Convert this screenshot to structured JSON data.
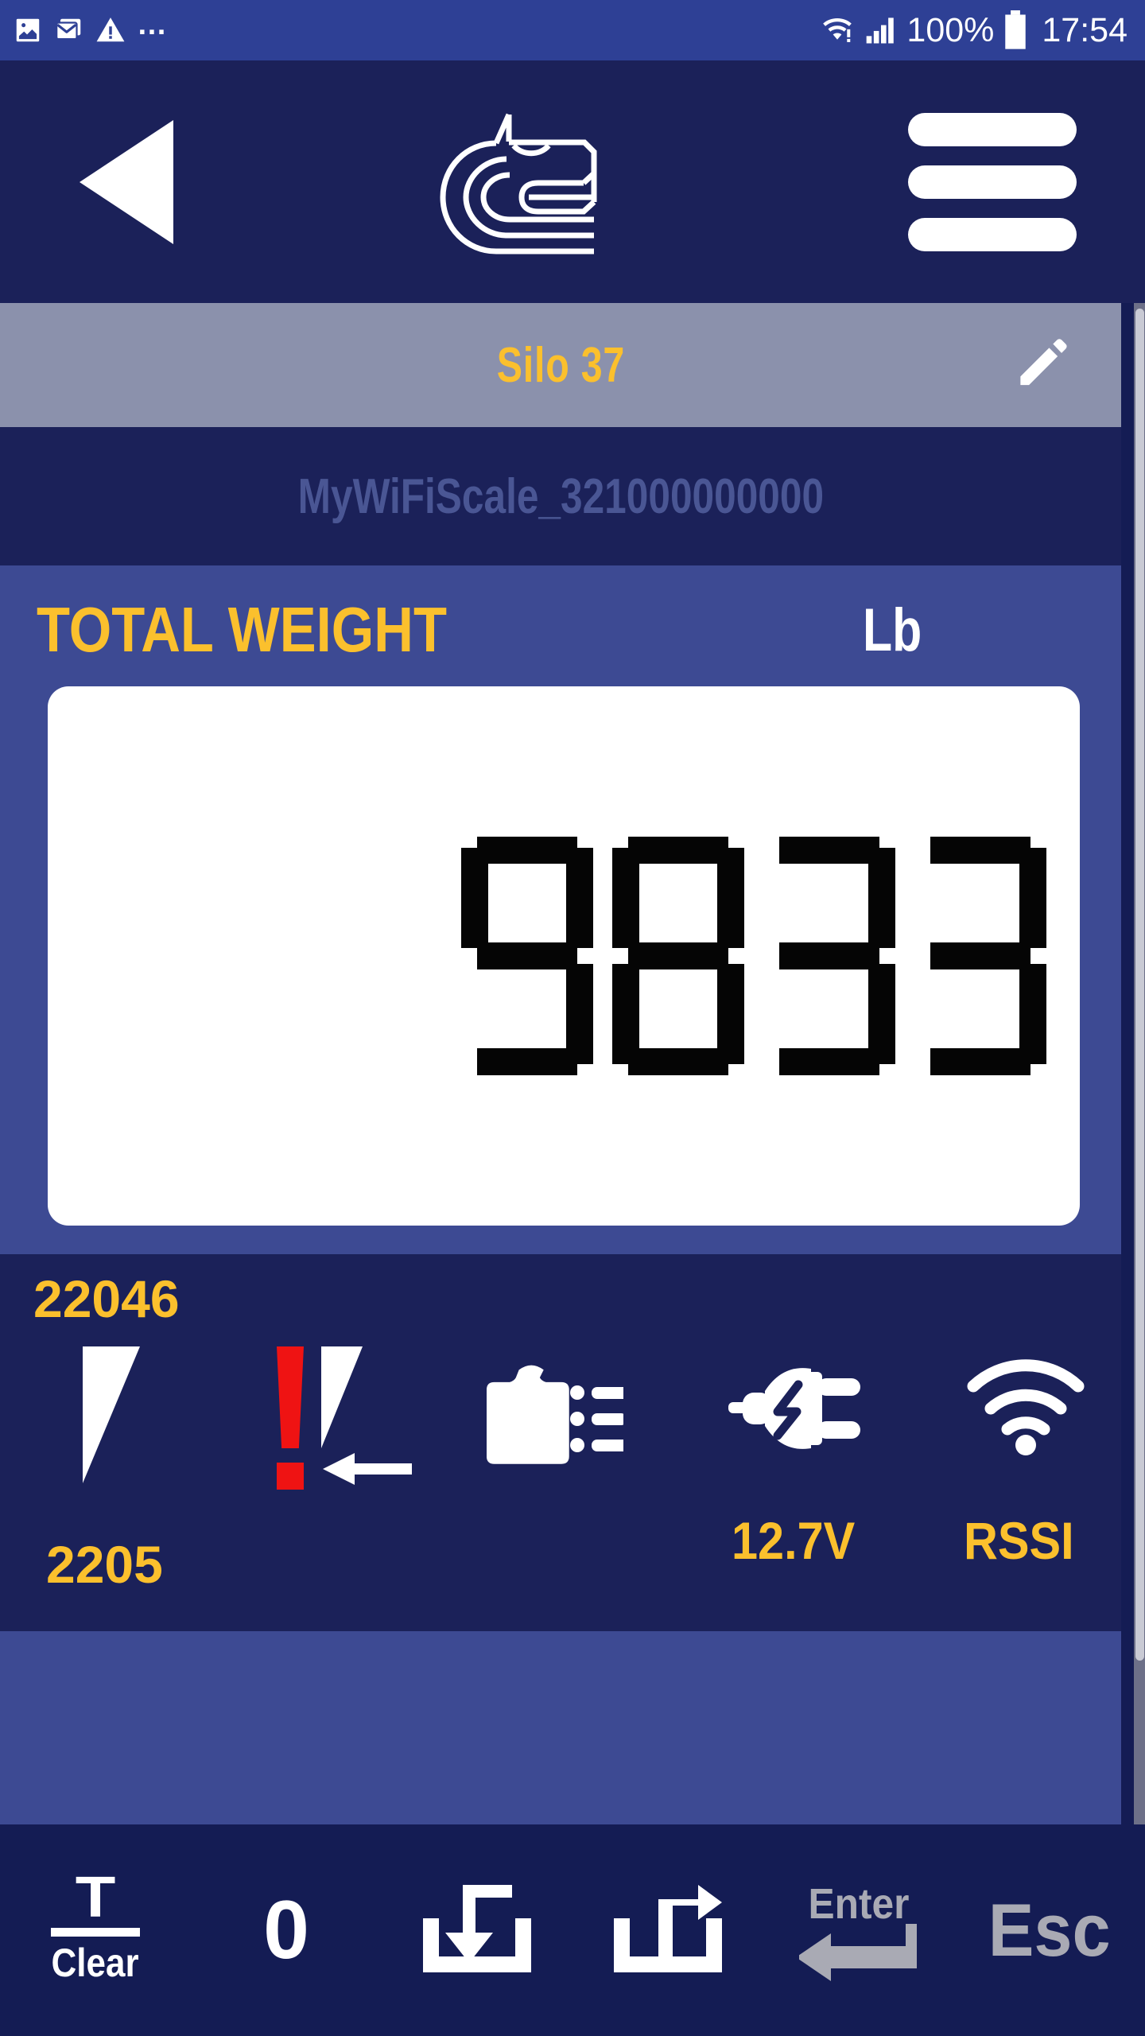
{
  "status_bar": {
    "left_icons": [
      "image-icon",
      "email-icon",
      "warning-icon"
    ],
    "overflow": "…",
    "wifi_icon": "wifi-exclamation-icon",
    "signal_icon": "cellular-signal-icon",
    "battery_percent": "100%",
    "battery_icon": "battery-full-icon",
    "time": "17:54"
  },
  "app_bar": {
    "back_icon": "back-triangle-icon",
    "logo_icon": "brand-animal-head-logo",
    "menu_icon": "hamburger-menu-icon"
  },
  "title_bar": {
    "title": "Silo 37",
    "edit_icon": "pencil-edit-icon"
  },
  "device_bar": {
    "device_name": "MyWiFiScale_321000000000"
  },
  "weight_panel": {
    "label": "TOTAL WEIGHT",
    "unit": "Lb",
    "display_value": "9833",
    "digits": [
      "9",
      "8",
      "3",
      "3"
    ]
  },
  "status_row": {
    "capacity_max": "22046",
    "capacity_min": "2205",
    "level_icon": "level-wedge-icon",
    "alarm_icon": "alarm-setpoint-icon",
    "calibration_icon": "calibration-weight-list-icon",
    "power_icon": "power-plug-icon",
    "wifi_icon": "wifi-signal-icon",
    "voltage": "12.7V",
    "rssi_label": "RSSI"
  },
  "toolbar": {
    "buttons": [
      {
        "name": "tare-clear",
        "top": "T",
        "label": "Clear",
        "enabled": true
      },
      {
        "name": "zero",
        "top": "0",
        "label": "",
        "enabled": true
      },
      {
        "name": "import",
        "top": "",
        "label": "",
        "enabled": true
      },
      {
        "name": "export",
        "top": "",
        "label": "",
        "enabled": true
      },
      {
        "name": "enter",
        "top": "",
        "label": "Enter",
        "enabled": false
      },
      {
        "name": "escape",
        "top": "",
        "label": "Esc",
        "enabled": false
      }
    ]
  },
  "colors": {
    "status_bar_blue": "#2e4095",
    "navy": "#1b2159",
    "panel_blue": "#3d4a93",
    "toolbar_navy": "#141c54",
    "title_gray": "#8b91ac",
    "gold": "#fbc02d",
    "muted_blue_text": "#4a5694",
    "disabled_gray": "#a9aab4",
    "alarm_red": "#ef1313"
  }
}
